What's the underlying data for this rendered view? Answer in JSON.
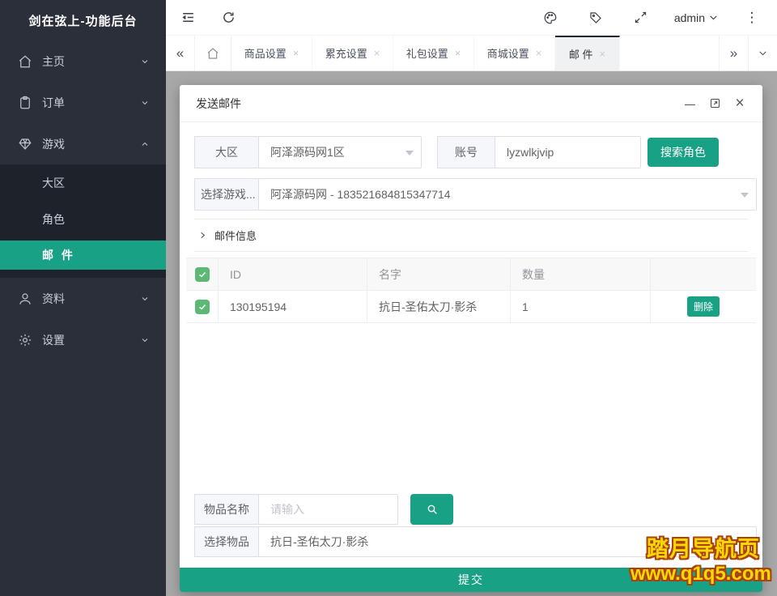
{
  "colors": {
    "accent": "#18a185",
    "checkbox_green": "#5bb974",
    "sidebar_bg": "#2b2f3a",
    "submenu_bg": "#1e222b",
    "overlay": "#a8a8a8",
    "watermark_yellow": "#ffd700",
    "watermark_outline": "#a84311"
  },
  "sidebar": {
    "title": "剑在弦上-功能后台",
    "items": [
      {
        "label": "主页",
        "icon": "home"
      },
      {
        "label": "订单",
        "icon": "order"
      },
      {
        "label": "游戏",
        "icon": "game",
        "expanded": true
      },
      {
        "label": "资料",
        "icon": "profile"
      },
      {
        "label": "设置",
        "icon": "settings"
      }
    ],
    "game_children": [
      {
        "label": "大区"
      },
      {
        "label": "角色"
      },
      {
        "label": "邮 件",
        "active": true
      }
    ]
  },
  "topbar": {
    "username": "admin"
  },
  "tabbar": {
    "tabs": [
      {
        "label": "商品设置"
      },
      {
        "label": "累充设置"
      },
      {
        "label": "礼包设置"
      },
      {
        "label": "商城设置"
      },
      {
        "label": "邮 件",
        "active": true
      }
    ]
  },
  "modal": {
    "title": "发送邮件",
    "region": {
      "label": "大区",
      "value": "阿泽源码网1区"
    },
    "account": {
      "label": "账号",
      "value": "lyzwlkjvip"
    },
    "search_role_button": "搜索角色",
    "game": {
      "label": "选择游戏...",
      "value": "阿泽源码网 - 183521684815347714"
    },
    "mail_info_collapse": "邮件信息",
    "table": {
      "headers": {
        "id": "ID",
        "name": "名字",
        "qty": "数量"
      },
      "rows": [
        {
          "id": "130195194",
          "name": "抗日-圣佑太刀·影杀",
          "qty": "1",
          "action": "删除"
        }
      ]
    },
    "item_name": {
      "label": "物品名称",
      "placeholder": "请输入"
    },
    "select_item": {
      "label": "选择物品",
      "value": "抗日-圣佑太刀·影杀"
    },
    "submit_label": "提交"
  },
  "watermark": {
    "line1": "踏月导航页",
    "line2": "www.q1q5.com"
  }
}
